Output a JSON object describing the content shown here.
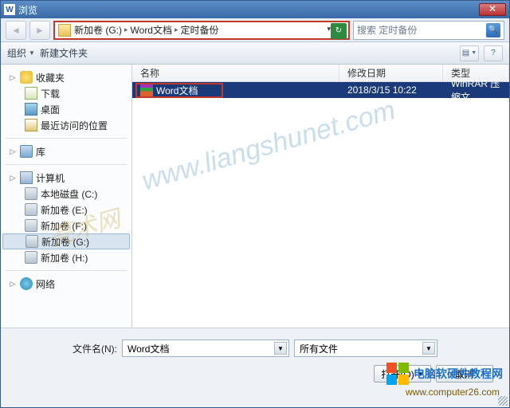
{
  "window": {
    "title": "浏览"
  },
  "address": {
    "seg1": "新加卷 (G:)",
    "seg2": "Word文档",
    "seg3": "定时备份"
  },
  "search": {
    "placeholder": "搜索 定时备份"
  },
  "toolbar": {
    "organize": "组织",
    "newfolder": "新建文件夹"
  },
  "tree": {
    "favorites": "收藏夹",
    "downloads": "下载",
    "desktop": "桌面",
    "recent": "最近访问的位置",
    "libraries": "库",
    "computer": "计算机",
    "drive_c": "本地磁盘 (C:)",
    "drive_e": "新加卷 (E:)",
    "drive_f": "新加卷 (F:)",
    "drive_g": "新加卷 (G:)",
    "drive_h": "新加卷 (H:)",
    "network": "网络"
  },
  "columns": {
    "name": "名称",
    "modified": "修改日期",
    "type": "类型"
  },
  "file": {
    "name": "Word文档",
    "date": "2018/3/15 10:22",
    "type": "WinRAR 压缩文"
  },
  "bottom": {
    "filename_label": "文件名(N):",
    "filename_value": "Word文档",
    "filter": "所有文件",
    "open": "打开(O)",
    "cancel": "取消"
  },
  "wm": {
    "url": "www.liangshunet.com",
    "cn": "亮术网"
  },
  "brand": {
    "text": "电脑软硬件教程网",
    "url": "www.computer26.com"
  }
}
